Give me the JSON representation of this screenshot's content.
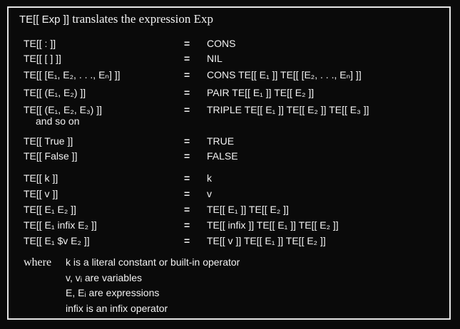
{
  "title": {
    "te": "TE[[ Exp ]]",
    "text": "translates the expression Exp"
  },
  "rules": [
    {
      "lhs": "TE[[ : ]]",
      "eq": "=",
      "rhs": "CONS"
    },
    {
      "lhs": "TE[[ [ ] ]]",
      "eq": "=",
      "rhs": "NIL"
    },
    {
      "lhs": "TE[[ [E₁, E₂, . . ., Eₙ] ]]",
      "eq": "=",
      "rhs": "CONS TE[[ E₁ ]] TE[[ [E₂, . . ., Eₙ] ]]"
    },
    {
      "lhs": "TE[[ (E₁, E₂) ]]",
      "eq": "=",
      "rhs": "PAIR TE[[ E₁ ]] TE[[ E₂ ]]"
    },
    {
      "lhs": "TE[[ (E₁, E₂, E₃) ]]",
      "eq": "=",
      "rhs": "TRIPLE TE[[ E₁ ]] TE[[ E₂ ]] TE[[ E₃ ]]"
    },
    {
      "lhs": "TE[[ True ]]",
      "eq": "=",
      "rhs": "TRUE"
    },
    {
      "lhs": "TE[[ False ]]",
      "eq": "=",
      "rhs": "FALSE"
    },
    {
      "lhs": "TE[[ k ]]",
      "eq": "=",
      "rhs": "k"
    },
    {
      "lhs": "TE[[ v ]]",
      "eq": "=",
      "rhs": "v"
    },
    {
      "lhs": "TE[[ E₁ E₂ ]]",
      "eq": "=",
      "rhs": "TE[[ E₁ ]] TE[[ E₂ ]]"
    },
    {
      "lhs": "TE[[ E₁ infix E₂ ]]",
      "eq": "=",
      "rhs": "TE[[ infix ]] TE[[ E₁ ]] TE[[ E₂ ]]"
    },
    {
      "lhs": "TE[[ E₁ $v E₂ ]]",
      "eq": "=",
      "rhs": "TE[[ v ]] TE[[ E₁ ]] TE[[ E₂ ]]"
    }
  ],
  "and_so_on": "and so on",
  "where": {
    "word": "where",
    "lines": [
      "k is a literal constant or built-in operator",
      "v, vᵢ are variables",
      "E, Eᵢ are expressions",
      "infix is an infix operator"
    ]
  }
}
